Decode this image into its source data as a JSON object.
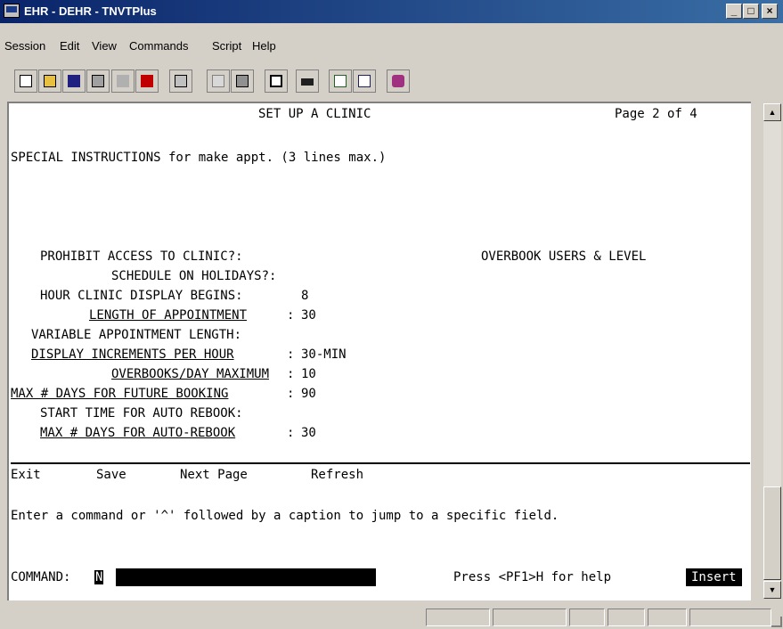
{
  "window": {
    "title": "EHR - DEHR - TNVTPlus"
  },
  "menu": [
    "Session",
    "Edit",
    "View",
    "Commands",
    "Script",
    "Help"
  ],
  "toolbar": {
    "buttons": [
      "new-icon",
      "open-icon",
      "save-icon",
      "properties-icon",
      "disconnect-icon",
      "connect-icon",
      "print-icon",
      "copy-icon",
      "paste-icon",
      "blank-screen-icon",
      "keyboard-icon",
      "send-file-icon",
      "receive-file-icon",
      "macro-book-icon"
    ]
  },
  "screen": {
    "title": "SET UP A CLINIC",
    "page": "Page 2 of 4",
    "special_instructions": "SPECIAL INSTRUCTIONS for make appt. (3 lines max.)",
    "overbook_header": "OVERBOOK USERS & LEVEL",
    "fields": [
      {
        "label": "PROHIBIT ACCESS TO CLINIC?:",
        "value": ""
      },
      {
        "label": "SCHEDULE ON HOLIDAYS?:",
        "value": ""
      },
      {
        "label": "HOUR CLINIC DISPLAY BEGINS:",
        "value": "8"
      },
      {
        "label": "LENGTH OF APPOINTMENT",
        "value": "30"
      },
      {
        "label": "VARIABLE APPOINTMENT LENGTH:",
        "value": ""
      },
      {
        "label": "DISPLAY INCREMENTS PER HOUR",
        "value": "30-MIN"
      },
      {
        "label": "OVERBOOKS/DAY MAXIMUM",
        "value": "10"
      },
      {
        "label": "MAX # DAYS FOR FUTURE BOOKING",
        "value": "90"
      },
      {
        "label": "START TIME FOR AUTO REBOOK:",
        "value": ""
      },
      {
        "label": "MAX # DAYS FOR AUTO-REBOOK",
        "value": "30"
      }
    ],
    "actions": [
      "Exit",
      "Save",
      "Next Page",
      "Refresh"
    ],
    "hint": "Enter a command or '^' followed by a caption to jump to a specific field.",
    "command_label": "COMMAND:",
    "command_value": "N",
    "help": "Press <PF1>H for help",
    "mode": "Insert"
  }
}
